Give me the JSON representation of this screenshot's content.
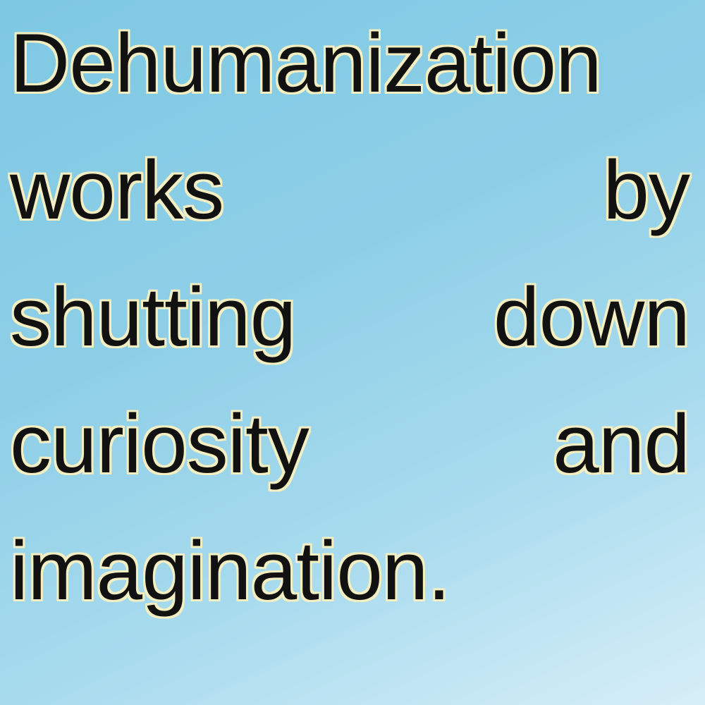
{
  "quote": {
    "lines": [
      {
        "words": [
          "Dehumanization"
        ]
      },
      {
        "words": [
          "works",
          "by"
        ]
      },
      {
        "words": [
          "shutting",
          "down"
        ]
      },
      {
        "words": [
          "curiosity",
          "and"
        ]
      },
      {
        "words": [
          "imagination."
        ]
      }
    ]
  },
  "colors": {
    "text": "#111111",
    "text_outline": "#f3efc2",
    "background_top": "#7ec8e3",
    "background_bottom": "#d6eef7"
  }
}
